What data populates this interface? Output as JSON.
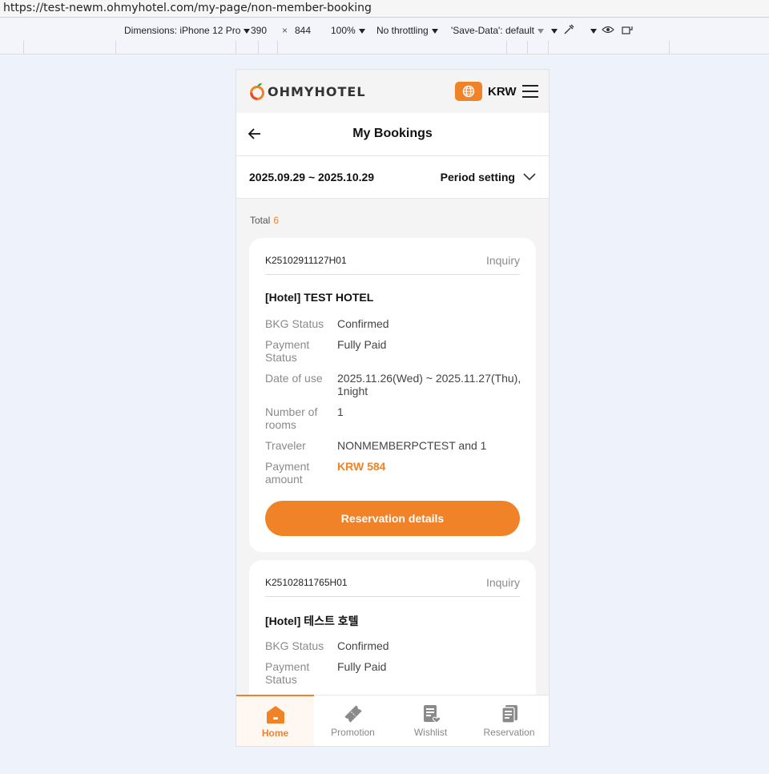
{
  "browser": {
    "url": "https://test-newm.ohmyhotel.com/my-page/non-member-booking"
  },
  "devtools": {
    "device": "Dimensions: iPhone 12 Pro",
    "width": "390",
    "times": "×",
    "height": "844",
    "zoom": "100%",
    "throttling": "No throttling",
    "save_data": "'Save-Data': default"
  },
  "header": {
    "logo_text": "OHMYHOTEL",
    "currency": "KRW"
  },
  "titlebar": {
    "title": "My Bookings"
  },
  "period": {
    "range": "2025.09.29 ~ 2025.10.29",
    "setting_label": "Period setting"
  },
  "total": {
    "label": "Total",
    "count": "6"
  },
  "bookings": [
    {
      "booking_no": "K25102911127H01",
      "inquiry": "Inquiry",
      "hotel": "[Hotel] TEST HOTEL",
      "rows": [
        {
          "label": "BKG Status",
          "value": "Confirmed"
        },
        {
          "label": "Payment Status",
          "value": "Fully Paid"
        },
        {
          "label": "Date of use",
          "value": "2025.11.26(Wed) ~ 2025.11.27(Thu), 1night"
        },
        {
          "label": "Number of rooms",
          "value": "1"
        },
        {
          "label": "Traveler",
          "value": "NONMEMBERPCTEST and 1"
        },
        {
          "label": "Payment amount",
          "value": "KRW 584"
        }
      ],
      "button": "Reservation details"
    },
    {
      "booking_no": "K25102811765H01",
      "inquiry": "Inquiry",
      "hotel": "[Hotel] 테스트 호텔",
      "rows": [
        {
          "label": "BKG Status",
          "value": "Confirmed"
        },
        {
          "label": "Payment Status",
          "value": "Fully Paid"
        }
      ]
    }
  ],
  "nav": [
    {
      "label": "Home"
    },
    {
      "label": "Promotion"
    },
    {
      "label": "Wishlist"
    },
    {
      "label": "Reservation"
    }
  ],
  "colors": {
    "accent": "#f08228",
    "background": "#f4f4f4"
  }
}
